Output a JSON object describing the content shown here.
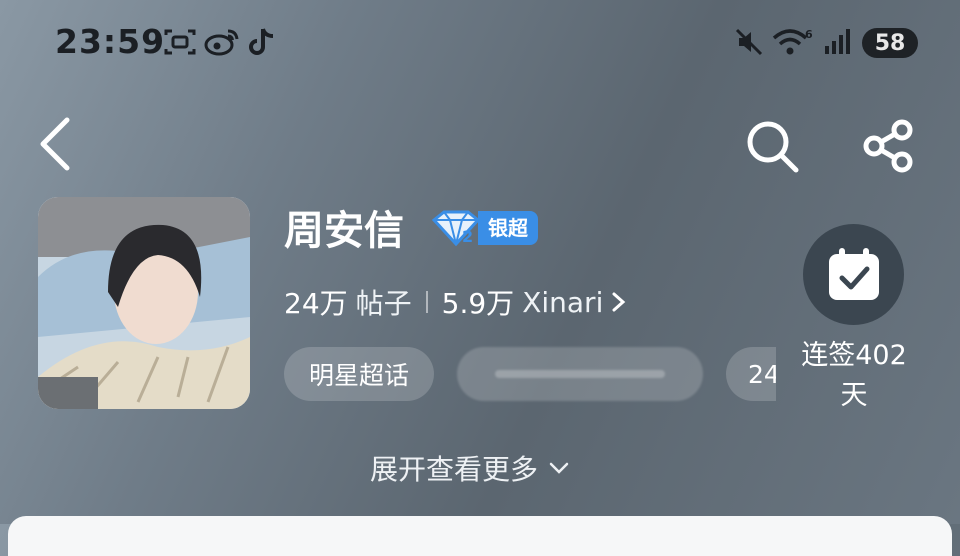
{
  "status_bar": {
    "time": "23:59",
    "battery": "58",
    "wifi_badge": "6"
  },
  "nav": {
    "back_icon": "back-arrow-icon",
    "search_icon": "search-icon",
    "share_icon": "share-icon"
  },
  "profile": {
    "name": "周安信",
    "badge_level": "2",
    "badge_label": "银超",
    "posts_count": "24万",
    "posts_label": "帖子",
    "fans_count": "5.9万",
    "fans_label": "Xinari"
  },
  "tags": [
    {
      "label": "明星超话"
    },
    {
      "label": ""
    },
    {
      "label": "24"
    }
  ],
  "checkin": {
    "label": "连签402天"
  },
  "expand_more": "展开查看更多",
  "colors": {
    "badge_blue": "#3a8ee6",
    "background": "#6f7c88"
  }
}
